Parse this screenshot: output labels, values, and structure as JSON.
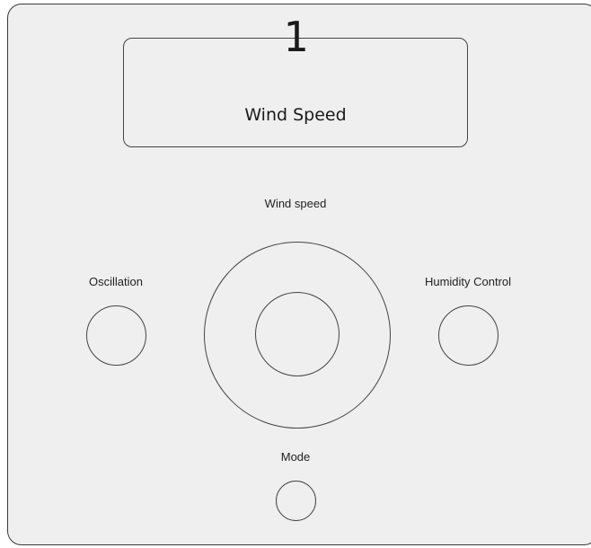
{
  "display": {
    "value": "1",
    "label": "Wind Speed"
  },
  "controls": {
    "wind_speed_label": "Wind speed",
    "oscillation_label": "Oscillation",
    "humidity_label": "Humidity Control",
    "mode_label": "Mode"
  },
  "colors": {
    "panel_background": "#efefef",
    "outline": "#444444",
    "text": "#1a1a1a"
  }
}
